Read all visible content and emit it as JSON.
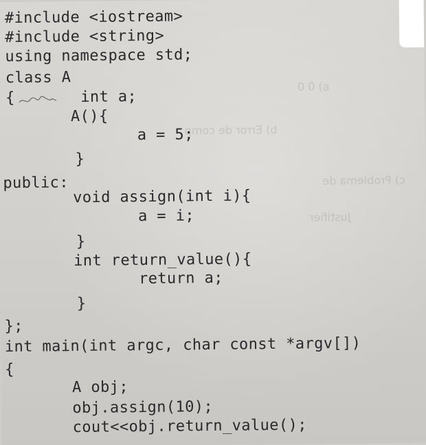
{
  "code_lines": [
    "#include <iostream>",
    "#include <string>",
    "using namespace std;",
    "class A",
    "{       int a;",
    "    A(){",
    "        a = 5;",
    "    }",
    "public:",
    "    void assign(int i){",
    "        a = i;",
    "    }",
    "    int return_value(){",
    "        return a;",
    "    }",
    "};",
    "int main(int argc, char const *argv[])",
    "{",
    "    A obj;",
    "    obj.assign(10);",
    "    cout<<obj.return_value();"
  ]
}
